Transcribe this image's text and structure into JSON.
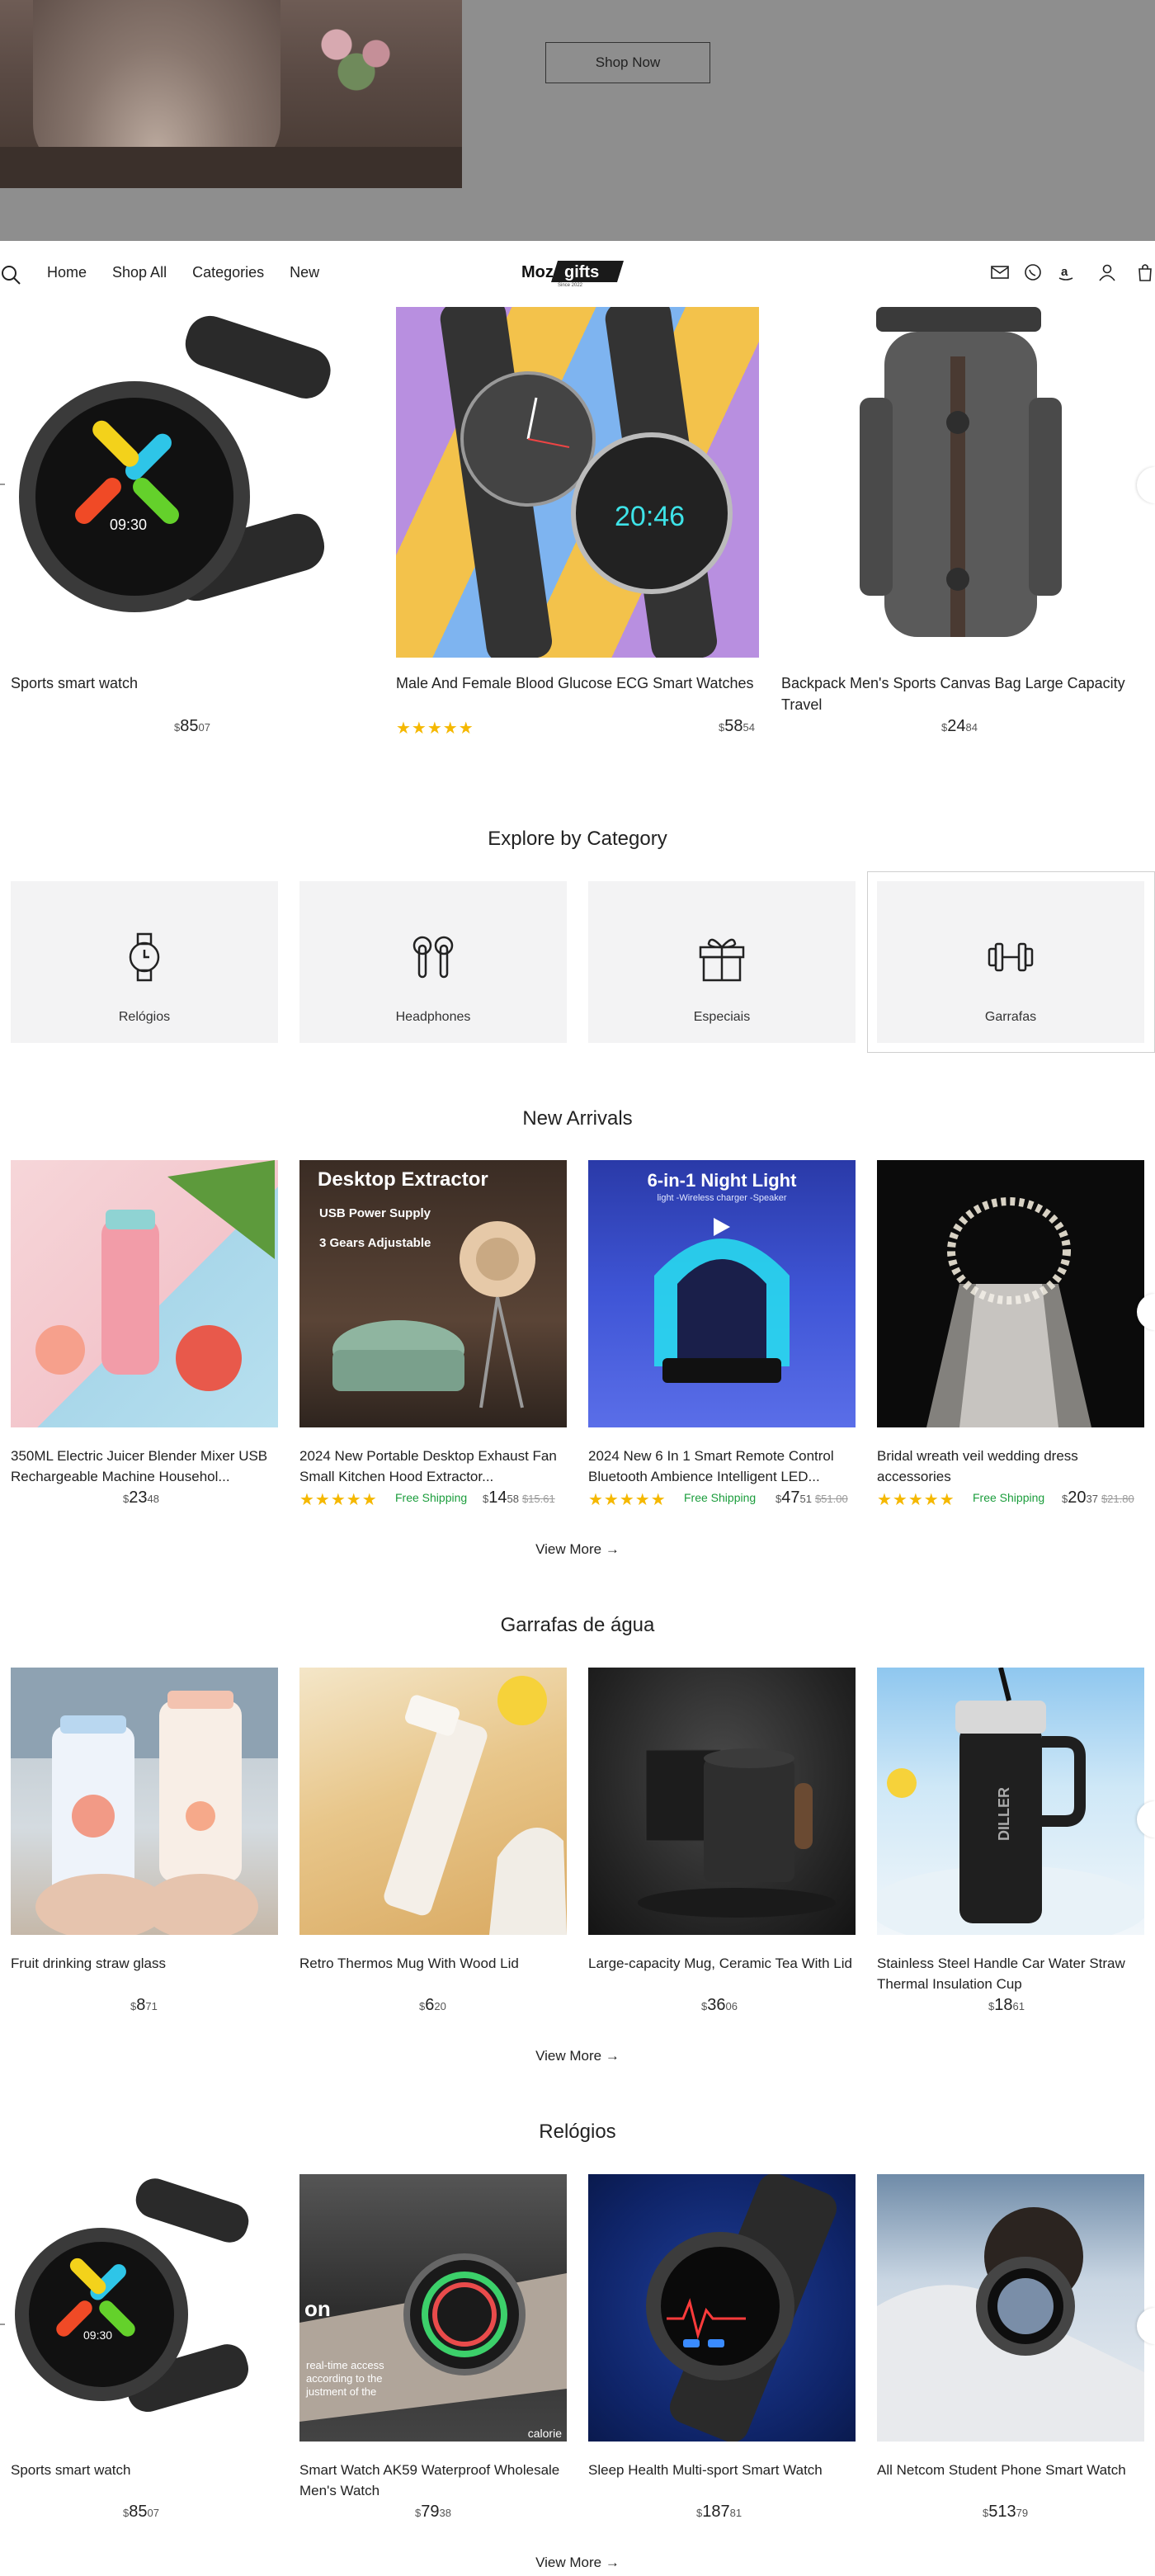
{
  "hero": {
    "cta_label": "Shop Now"
  },
  "header": {
    "nav": [
      "Home",
      "Shop All",
      "Categories",
      "New"
    ],
    "logo_text": "Moz gifts",
    "logo_tagline": "Since 2022"
  },
  "top_products": [
    {
      "title": "Sports smart watch",
      "price_currency": "$",
      "price_int": "85",
      "price_cents": "07",
      "rating": 0
    },
    {
      "title": "Male And Female Blood Glucose ECG Smart Watches",
      "price_currency": "$",
      "price_int": "58",
      "price_cents": "54",
      "rating": 5,
      "stars": "★★★★★"
    },
    {
      "title": "Backpack Men's Sports Canvas Bag Large Capacity Travel",
      "price_currency": "$",
      "price_int": "24",
      "price_cents": "84",
      "rating": 0
    }
  ],
  "categories_section": {
    "title": "Explore by Category",
    "items": [
      {
        "label": "Relógios",
        "icon": "watch-icon"
      },
      {
        "label": "Headphones",
        "icon": "earbuds-icon"
      },
      {
        "label": "Especiais",
        "icon": "gift-icon"
      },
      {
        "label": "Garrafas",
        "icon": "dumbbell-icon"
      }
    ]
  },
  "new_arrivals": {
    "title": "New Arrivals",
    "view_more": "View More",
    "products": [
      {
        "title": "350ML Electric Juicer Blender Mixer USB Rechargeable Machine Househol...",
        "price_currency": "$",
        "price_int": "23",
        "price_cents": "48"
      },
      {
        "title": "2024 New Portable Desktop Exhaust Fan Small Kitchen Hood Extractor...",
        "price_currency": "$",
        "price_int": "14",
        "price_cents": "58",
        "old_price": "$15.61",
        "stars": "★★★★★",
        "shipping": "Free Shipping",
        "img_heading": "Desktop Extractor",
        "img_line1": "USB Power Supply",
        "img_line2": "3 Gears Adjustable"
      },
      {
        "title": "2024 New 6 In 1 Smart Remote Control Bluetooth Ambience Intelligent LED...",
        "price_currency": "$",
        "price_int": "47",
        "price_cents": "51",
        "old_price": "$51.00",
        "stars": "★★★★★",
        "shipping": "Free Shipping",
        "img_heading": "6-in-1 Night Light",
        "img_sub": "light -Wireless charger -Speaker"
      },
      {
        "title": "Bridal wreath veil wedding dress accessories",
        "price_currency": "$",
        "price_int": "20",
        "price_cents": "37",
        "old_price": "$21.80",
        "stars": "★★★★★",
        "shipping": "Free Shipping"
      }
    ]
  },
  "bottles": {
    "title": "Garrafas de água",
    "view_more": "View More",
    "products": [
      {
        "title": "Fruit drinking straw glass",
        "price_currency": "$",
        "price_int": "8",
        "price_cents": "71"
      },
      {
        "title": "Retro Thermos Mug With Wood Lid",
        "price_currency": "$",
        "price_int": "6",
        "price_cents": "20"
      },
      {
        "title": "Large-capacity Mug, Ceramic Tea With Lid",
        "price_currency": "$",
        "price_int": "36",
        "price_cents": "06"
      },
      {
        "title": "Stainless Steel Handle Car Water Straw Thermal Insulation Cup",
        "price_currency": "$",
        "price_int": "18",
        "price_cents": "61",
        "img_brand": "DILLER"
      }
    ]
  },
  "watches": {
    "title": "Relógios",
    "view_more": "View More",
    "products": [
      {
        "title": "Sports smart watch",
        "price_currency": "$",
        "price_int": "85",
        "price_cents": "07"
      },
      {
        "title": "Smart Watch AK59 Waterproof Wholesale Men's Watch",
        "price_currency": "$",
        "price_int": "79",
        "price_cents": "38",
        "img_line1": "on",
        "img_line2": "real-time access",
        "img_line3": "according to the",
        "img_line4": "justment of the",
        "img_corner": "calorie"
      },
      {
        "title": "Sleep Health Multi-sport Smart Watch",
        "price_currency": "$",
        "price_int": "187",
        "price_cents": "81"
      },
      {
        "title": "All Netcom Student Phone Smart Watch",
        "price_currency": "$",
        "price_int": "513",
        "price_cents": "79"
      }
    ]
  },
  "colors": {
    "star": "#f5b800",
    "shipping": "#1b9d3c",
    "hero_bg": "#8e8e8e",
    "category_bg": "#f3f3f4"
  }
}
